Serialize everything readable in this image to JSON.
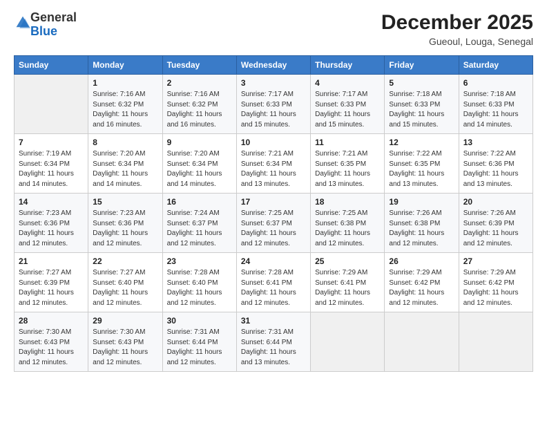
{
  "logo": {
    "general": "General",
    "blue": "Blue"
  },
  "title": "December 2025",
  "subtitle": "Gueoul, Louga, Senegal",
  "header_days": [
    "Sunday",
    "Monday",
    "Tuesday",
    "Wednesday",
    "Thursday",
    "Friday",
    "Saturday"
  ],
  "weeks": [
    [
      {
        "num": "",
        "info": ""
      },
      {
        "num": "1",
        "info": "Sunrise: 7:16 AM\nSunset: 6:32 PM\nDaylight: 11 hours\nand 16 minutes."
      },
      {
        "num": "2",
        "info": "Sunrise: 7:16 AM\nSunset: 6:32 PM\nDaylight: 11 hours\nand 16 minutes."
      },
      {
        "num": "3",
        "info": "Sunrise: 7:17 AM\nSunset: 6:33 PM\nDaylight: 11 hours\nand 15 minutes."
      },
      {
        "num": "4",
        "info": "Sunrise: 7:17 AM\nSunset: 6:33 PM\nDaylight: 11 hours\nand 15 minutes."
      },
      {
        "num": "5",
        "info": "Sunrise: 7:18 AM\nSunset: 6:33 PM\nDaylight: 11 hours\nand 15 minutes."
      },
      {
        "num": "6",
        "info": "Sunrise: 7:18 AM\nSunset: 6:33 PM\nDaylight: 11 hours\nand 14 minutes."
      }
    ],
    [
      {
        "num": "7",
        "info": "Sunrise: 7:19 AM\nSunset: 6:34 PM\nDaylight: 11 hours\nand 14 minutes."
      },
      {
        "num": "8",
        "info": "Sunrise: 7:20 AM\nSunset: 6:34 PM\nDaylight: 11 hours\nand 14 minutes."
      },
      {
        "num": "9",
        "info": "Sunrise: 7:20 AM\nSunset: 6:34 PM\nDaylight: 11 hours\nand 14 minutes."
      },
      {
        "num": "10",
        "info": "Sunrise: 7:21 AM\nSunset: 6:34 PM\nDaylight: 11 hours\nand 13 minutes."
      },
      {
        "num": "11",
        "info": "Sunrise: 7:21 AM\nSunset: 6:35 PM\nDaylight: 11 hours\nand 13 minutes."
      },
      {
        "num": "12",
        "info": "Sunrise: 7:22 AM\nSunset: 6:35 PM\nDaylight: 11 hours\nand 13 minutes."
      },
      {
        "num": "13",
        "info": "Sunrise: 7:22 AM\nSunset: 6:36 PM\nDaylight: 11 hours\nand 13 minutes."
      }
    ],
    [
      {
        "num": "14",
        "info": "Sunrise: 7:23 AM\nSunset: 6:36 PM\nDaylight: 11 hours\nand 12 minutes."
      },
      {
        "num": "15",
        "info": "Sunrise: 7:23 AM\nSunset: 6:36 PM\nDaylight: 11 hours\nand 12 minutes."
      },
      {
        "num": "16",
        "info": "Sunrise: 7:24 AM\nSunset: 6:37 PM\nDaylight: 11 hours\nand 12 minutes."
      },
      {
        "num": "17",
        "info": "Sunrise: 7:25 AM\nSunset: 6:37 PM\nDaylight: 11 hours\nand 12 minutes."
      },
      {
        "num": "18",
        "info": "Sunrise: 7:25 AM\nSunset: 6:38 PM\nDaylight: 11 hours\nand 12 minutes."
      },
      {
        "num": "19",
        "info": "Sunrise: 7:26 AM\nSunset: 6:38 PM\nDaylight: 11 hours\nand 12 minutes."
      },
      {
        "num": "20",
        "info": "Sunrise: 7:26 AM\nSunset: 6:39 PM\nDaylight: 11 hours\nand 12 minutes."
      }
    ],
    [
      {
        "num": "21",
        "info": "Sunrise: 7:27 AM\nSunset: 6:39 PM\nDaylight: 11 hours\nand 12 minutes."
      },
      {
        "num": "22",
        "info": "Sunrise: 7:27 AM\nSunset: 6:40 PM\nDaylight: 11 hours\nand 12 minutes."
      },
      {
        "num": "23",
        "info": "Sunrise: 7:28 AM\nSunset: 6:40 PM\nDaylight: 11 hours\nand 12 minutes."
      },
      {
        "num": "24",
        "info": "Sunrise: 7:28 AM\nSunset: 6:41 PM\nDaylight: 11 hours\nand 12 minutes."
      },
      {
        "num": "25",
        "info": "Sunrise: 7:29 AM\nSunset: 6:41 PM\nDaylight: 11 hours\nand 12 minutes."
      },
      {
        "num": "26",
        "info": "Sunrise: 7:29 AM\nSunset: 6:42 PM\nDaylight: 11 hours\nand 12 minutes."
      },
      {
        "num": "27",
        "info": "Sunrise: 7:29 AM\nSunset: 6:42 PM\nDaylight: 11 hours\nand 12 minutes."
      }
    ],
    [
      {
        "num": "28",
        "info": "Sunrise: 7:30 AM\nSunset: 6:43 PM\nDaylight: 11 hours\nand 12 minutes."
      },
      {
        "num": "29",
        "info": "Sunrise: 7:30 AM\nSunset: 6:43 PM\nDaylight: 11 hours\nand 12 minutes."
      },
      {
        "num": "30",
        "info": "Sunrise: 7:31 AM\nSunset: 6:44 PM\nDaylight: 11 hours\nand 12 minutes."
      },
      {
        "num": "31",
        "info": "Sunrise: 7:31 AM\nSunset: 6:44 PM\nDaylight: 11 hours\nand 13 minutes."
      },
      {
        "num": "",
        "info": ""
      },
      {
        "num": "",
        "info": ""
      },
      {
        "num": "",
        "info": ""
      }
    ]
  ]
}
